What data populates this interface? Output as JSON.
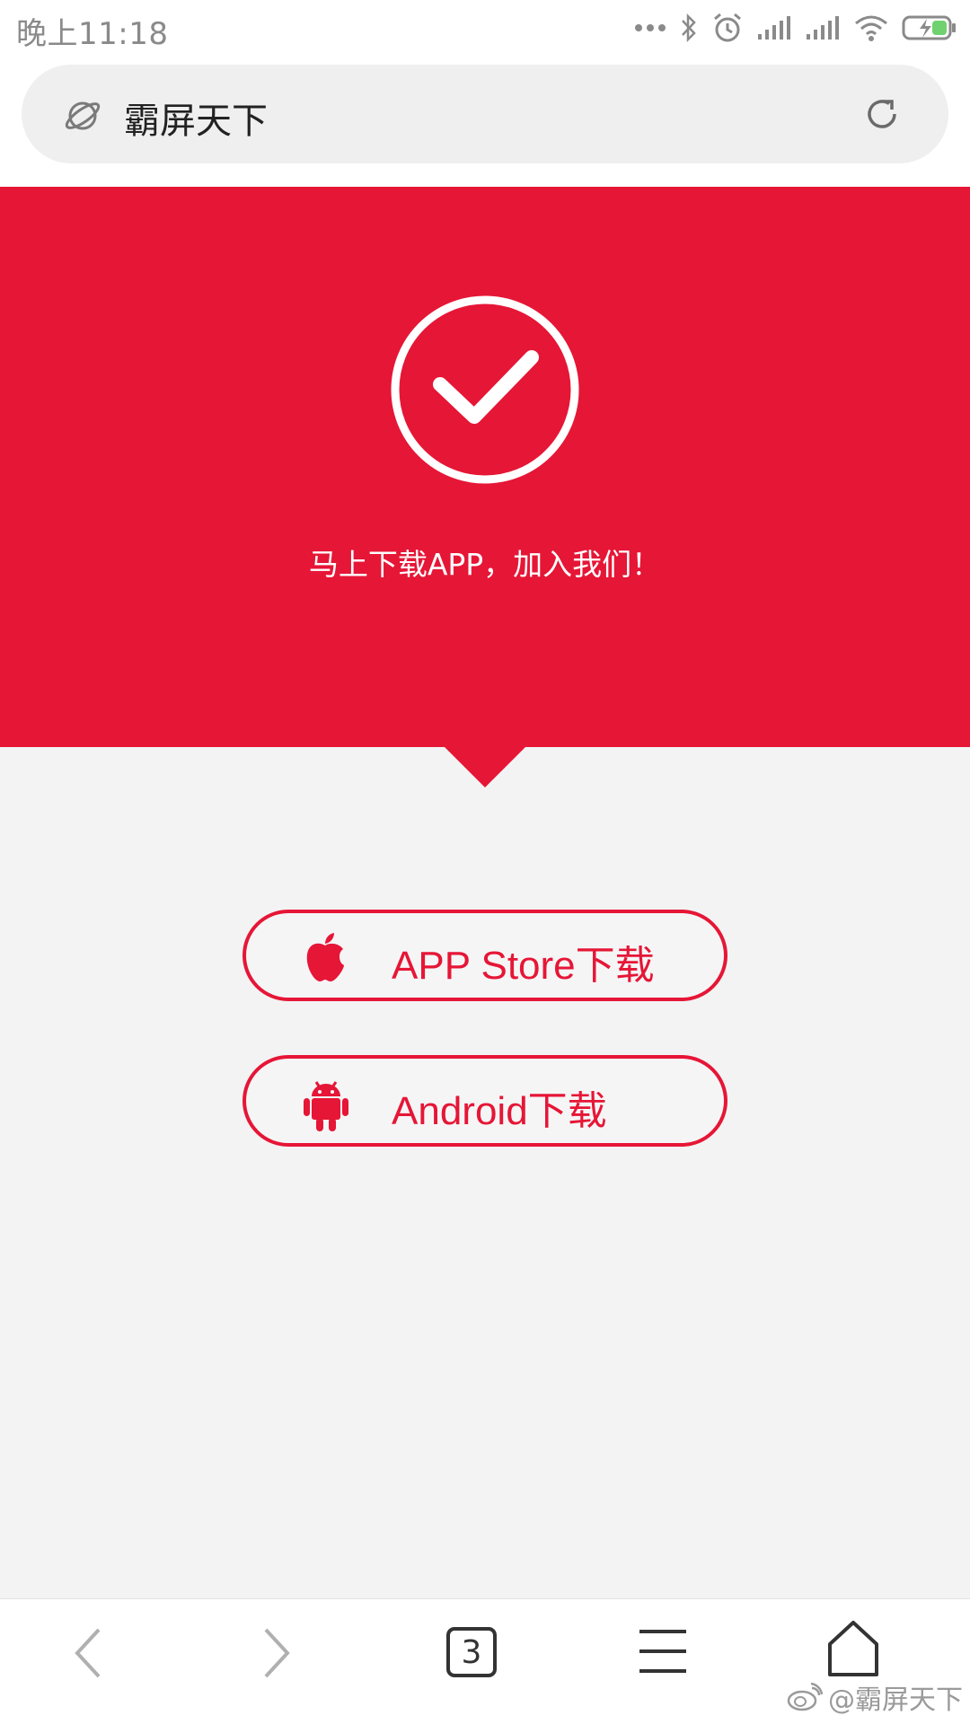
{
  "status_bar": {
    "time": "晚上11:18"
  },
  "address_bar": {
    "title": "霸屏天下",
    "left_icon": "globe-icon",
    "right_icon": "reload-icon"
  },
  "hero": {
    "message": "马上下载APP，加入我们！",
    "icon": "check-circle-icon"
  },
  "downloads": {
    "ios_label": "APP Store下载",
    "android_label": "Android下载"
  },
  "bottom_nav": {
    "tab_count": "3",
    "items": [
      "back-icon",
      "forward-icon",
      "tabs-icon",
      "menu-icon",
      "home-icon"
    ]
  },
  "watermark": {
    "text": "@霸屏天下"
  },
  "colors": {
    "brand_red": "#e61636",
    "page_bg": "#f3f3f4"
  }
}
